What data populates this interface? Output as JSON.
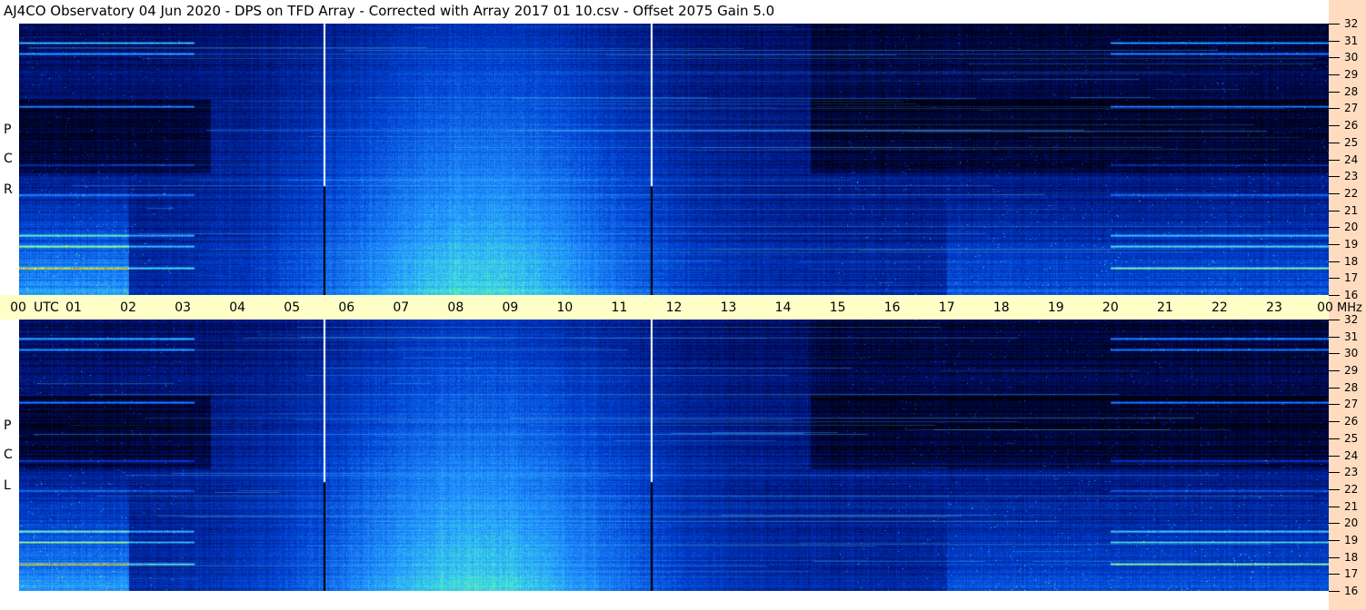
{
  "header": {
    "title": "AJ4CO Observatory  04 Jun 2020  -  DPS on TFD Array  -  Corrected with Array 2017 01 10.csv  -  Offset 2075  Gain 5.0"
  },
  "chart_data": {
    "type": "heatmap",
    "x_axis": {
      "label": "UTC",
      "ticks": [
        "00",
        "01",
        "02",
        "03",
        "04",
        "05",
        "06",
        "07",
        "08",
        "09",
        "10",
        "11",
        "12",
        "13",
        "14",
        "15",
        "16",
        "17",
        "18",
        "19",
        "20",
        "21",
        "22",
        "23",
        "00"
      ],
      "range": [
        0,
        24
      ]
    },
    "y_axis": {
      "label": "MHz",
      "ticks": [
        16,
        17,
        18,
        19,
        20,
        21,
        22,
        23,
        24,
        25,
        26,
        27,
        28,
        29,
        30,
        31,
        32
      ],
      "range": [
        16,
        32
      ]
    },
    "panels": [
      {
        "name": "RCP",
        "label_letters": [
          "P",
          "C",
          "R"
        ]
      },
      {
        "name": "LCP",
        "label_letters": [
          "P",
          "C",
          "L"
        ]
      }
    ],
    "markers_utc": [
      5.58,
      11.58
    ],
    "colormap": [
      "#000010",
      "#001070",
      "#0040d0",
      "#2090ff",
      "#40e0e0",
      "#a0ff60",
      "#ffff00",
      "#ff4000"
    ]
  },
  "colors": {
    "ruler_bg": "#ffffc8",
    "right_strip_bg": "#ffdcc0"
  }
}
